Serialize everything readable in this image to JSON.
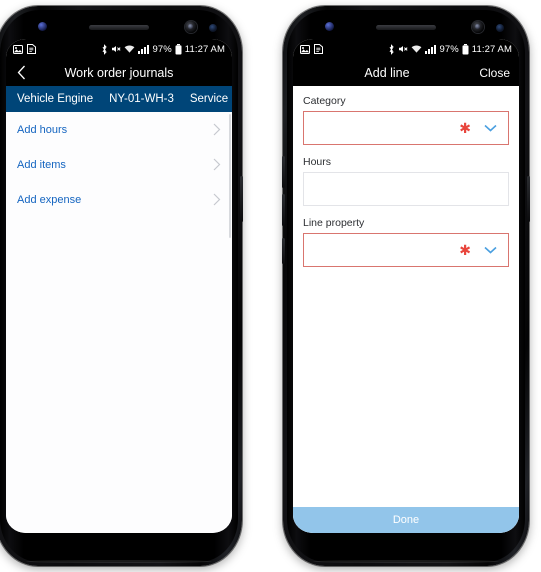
{
  "status_bar": {
    "battery_percent": "97%",
    "time": "11:27 AM",
    "icons": [
      "image-icon",
      "document-icon",
      "bluetooth-icon",
      "mute-icon",
      "wifi-icon",
      "signal-icon",
      "battery-icon"
    ]
  },
  "left_phone": {
    "title": "Work order journals",
    "back_icon": "chevron-left-icon",
    "context_bar": {
      "item1": "Vehicle Engine",
      "item2": "NY-01-WH-3",
      "item3": "Service"
    },
    "list": [
      {
        "label": "Add hours",
        "chevron": "chevron-right-icon"
      },
      {
        "label": "Add items",
        "chevron": "chevron-right-icon"
      },
      {
        "label": "Add expense",
        "chevron": "chevron-right-icon"
      }
    ]
  },
  "right_phone": {
    "title": "Add line",
    "close_label": "Close",
    "fields": [
      {
        "label": "Category",
        "value": "",
        "required": true,
        "control": "dropdown"
      },
      {
        "label": "Hours",
        "value": "",
        "required": false,
        "control": "text"
      },
      {
        "label": "Line property",
        "value": "",
        "required": true,
        "control": "dropdown"
      }
    ],
    "primary_button": "Done"
  },
  "nav_bar": {
    "icons": [
      "dot-icon",
      "recents-icon",
      "home-icon",
      "back-icon"
    ]
  },
  "colors": {
    "context_bar_blue": "#004578",
    "link_blue": "#1565c0",
    "done_button_blue": "#92c5ea",
    "required_border_red": "#d9756f",
    "asterisk_red": "#e8453c",
    "chevron_blue": "#4a9fe0"
  }
}
